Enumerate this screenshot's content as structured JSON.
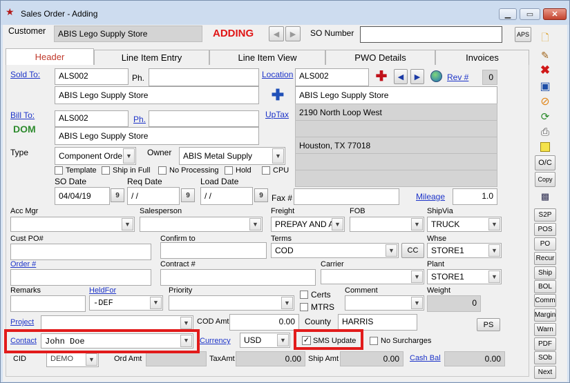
{
  "window": {
    "title": "Sales Order - Adding",
    "minimize": "▁",
    "maximize": "▭",
    "close": "✕"
  },
  "top": {
    "customer_label": "Customer",
    "customer_value": "ABIS Lego Supply Store",
    "mode": "ADDING",
    "so_number_label": "SO Number",
    "so_number_value": "",
    "aps": "APS"
  },
  "tabs": [
    "Header",
    "Line Item Entry",
    "Line Item View",
    "PWO Details",
    "Invoices"
  ],
  "sold_to": {
    "label": "Sold To:",
    "code": "ALS002",
    "ph_label": "Ph.",
    "ph": "",
    "name": "ABIS Lego Supply Store"
  },
  "bill_to": {
    "label": "Bill To:",
    "code": "ALS002",
    "ph_label": "Ph.",
    "ph": "",
    "name": "ABIS Lego Supply Store",
    "dom": "DOM"
  },
  "location": {
    "label": "Location",
    "code": "ALS002",
    "rev_label": "Rev #",
    "rev": "0",
    "uptax": "UpTax",
    "lines": [
      "ABIS Lego Supply Store",
      "2190 North Loop West",
      "",
      "Houston, TX  77018",
      "",
      ""
    ]
  },
  "type": {
    "label": "Type",
    "value": "Component Orde",
    "owner_label": "Owner",
    "owner": "ABIS Metal Supply"
  },
  "checks": {
    "template": "Template",
    "ship_full": "Ship in Full",
    "no_processing": "No Processing",
    "hold": "Hold",
    "cpu": "CPU"
  },
  "dates": {
    "so_label": "SO Date",
    "so": "04/04/19",
    "req_label": "Req Date",
    "req": "/ /",
    "load_label": "Load Date",
    "load": "/ /",
    "cal": "9"
  },
  "fax": {
    "label": "Fax #",
    "value": ""
  },
  "mileage": {
    "label": "Mileage",
    "value": "1.0"
  },
  "row1": {
    "acc_mgr": "Acc Mgr",
    "salesperson": "Salesperson",
    "freight": "Freight",
    "freight_value": "PREPAY AND AD",
    "fob": "FOB",
    "shipvia": "ShipVia",
    "shipvia_value": "TRUCK"
  },
  "row2": {
    "cust_po": "Cust PO#",
    "confirm": "Confirm to",
    "terms": "Terms",
    "terms_value": "COD",
    "cc": "CC",
    "whse": "Whse",
    "whse_value": "STORE1"
  },
  "row3": {
    "order": "Order #",
    "contract": "Contract #",
    "carrier": "Carrier",
    "plant": "Plant",
    "plant_value": "STORE1"
  },
  "row4": {
    "remarks": "Remarks",
    "heldfor": "HeldFor",
    "heldfor_value": "-DEF",
    "priority": "Priority",
    "certs": "Certs",
    "mtrs": "MTRS",
    "comment": "Comment",
    "weight": "Weight",
    "weight_value": "0"
  },
  "row5": {
    "project": "Project",
    "cod_amt": "COD Amt",
    "cod_value": "0.00",
    "county": "County",
    "county_value": "HARRIS",
    "ps": "PS"
  },
  "row6": {
    "contact": "Contact",
    "contact_value": "John Doe",
    "currency": "Currency",
    "currency_value": "USD",
    "sms": "SMS Update",
    "no_surcharges": "No Surcharges"
  },
  "row7": {
    "cid": "CID",
    "cid_value": "DEMO",
    "ord_amt": "Ord Amt",
    "ord_value": "",
    "tax_amt": "TaxAmt",
    "tax_value": "0.00",
    "ship_amt": "Ship Amt",
    "ship_value": "0.00",
    "cash_bal": "Cash Bal",
    "cash_value": "0.00"
  },
  "side_text": {
    "oc": "O/C",
    "copy": "Copy"
  },
  "side_buttons": [
    "S2P",
    "POS",
    "PO",
    "Recur",
    "Ship",
    "BOL",
    "Comm",
    "Margin",
    "Warn",
    "PDF",
    "SOb",
    "Next"
  ]
}
